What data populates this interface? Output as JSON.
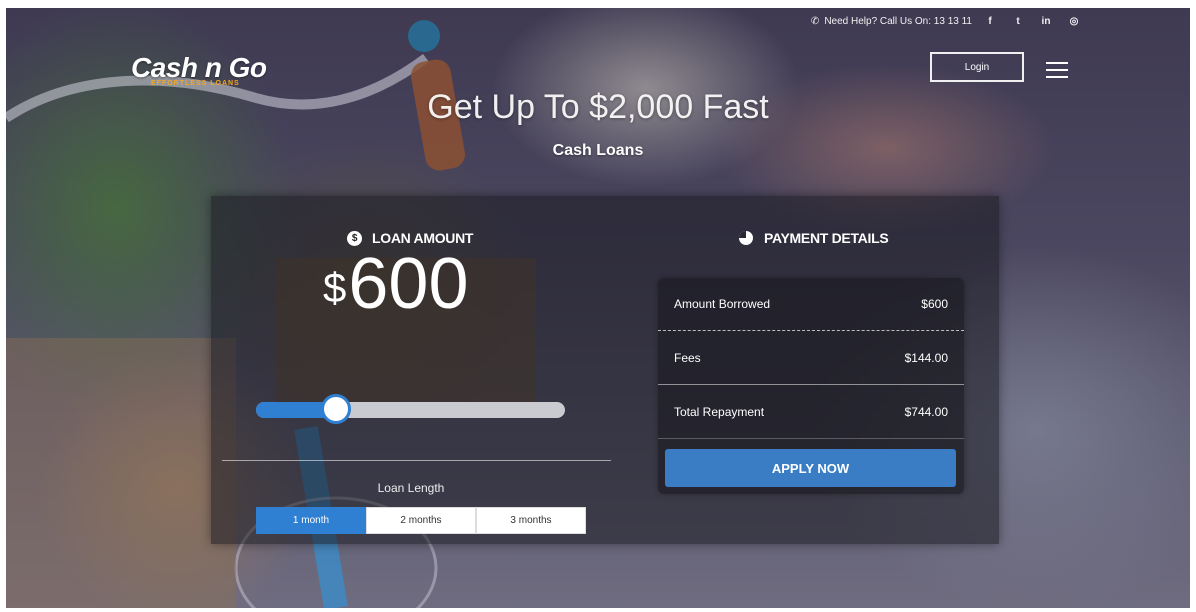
{
  "header": {
    "help_text": "Need Help? Call Us On: 13 13 11",
    "social": [
      "facebook-icon",
      "twitter-icon",
      "linkedin-icon",
      "instagram-icon"
    ],
    "social_glyphs": [
      "f",
      "t",
      "in",
      "◎"
    ],
    "logo_text": "Cash n Go",
    "logo_tagline": "EFFORTLESS LOANS",
    "login_label": "Login"
  },
  "hero": {
    "title": "Get Up To $2,000 Fast",
    "subtitle": "Cash Loans"
  },
  "calculator": {
    "loan_amount_title": "LOAN AMOUNT",
    "currency_symbol": "$",
    "amount_value": "600",
    "slider_fraction": 0.26,
    "loan_length_label": "Loan Length",
    "terms": [
      {
        "label": "1 month",
        "active": true
      },
      {
        "label": "2 months",
        "active": false
      },
      {
        "label": "3 months",
        "active": false
      }
    ]
  },
  "payment": {
    "title": "PAYMENT DETAILS",
    "rows": [
      {
        "label": "Amount Borrowed",
        "value": "$600"
      },
      {
        "label": "Fees",
        "value": "$144.00"
      },
      {
        "label": "Total Repayment",
        "value": "$744.00"
      }
    ],
    "apply_label": "APPLY NOW"
  },
  "colors": {
    "accent": "#2f7fd2",
    "logo_orange": "#f5a623",
    "button_blue": "#3b7dc4"
  }
}
